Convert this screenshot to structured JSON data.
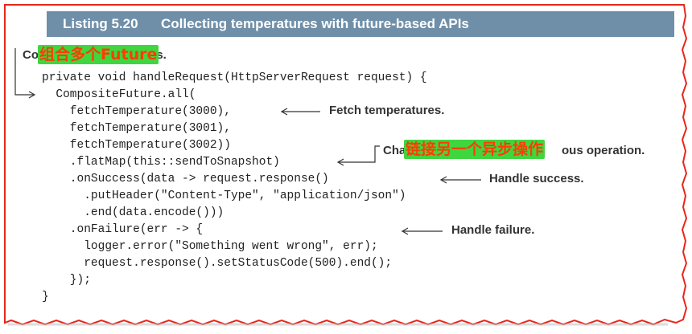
{
  "listing": {
    "number": "Listing 5.20",
    "title": "Collecting temperatures with future-based APIs"
  },
  "annotations": {
    "compose_prefix": "Co",
    "compose_suffix": "es.",
    "chain_prefix": "Cha",
    "chain_suffix": "ous operation.",
    "fetch": "Fetch temperatures.",
    "success": "Handle success.",
    "failure": "Handle failure."
  },
  "overlays": {
    "compose": "组合多个Future",
    "chain": "链接另一个异步操作"
  },
  "code_lines": [
    "private void handleRequest(HttpServerRequest request) {",
    "  CompositeFuture.all(",
    "    fetchTemperature(3000),",
    "    fetchTemperature(3001),",
    "    fetchTemperature(3002))",
    "    .flatMap(this::sendToSnapshot)",
    "    .onSuccess(data -> request.response()",
    "      .putHeader(\"Content-Type\", \"application/json\")",
    "      .end(data.encode()))",
    "    .onFailure(err -> {",
    "      logger.error(\"Something went wrong\", err);",
    "      request.response().setStatusCode(500).end();",
    "    });",
    "}"
  ],
  "colors": {
    "header_bg": "#6f8fa9",
    "frame_red": "#e8261b",
    "overlay_bg": "#3fd63f",
    "overlay_text": "#ff3d00"
  }
}
